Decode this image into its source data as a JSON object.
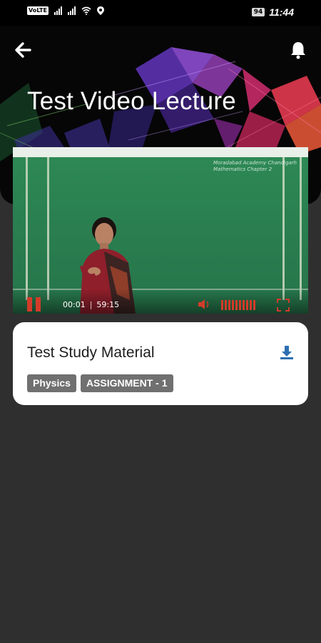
{
  "status_bar": {
    "network_badge": "VoLTE",
    "battery_level": "94",
    "time": "11:44",
    "icons": [
      "volte-icon",
      "signal-icon",
      "signal-icon",
      "wifi-icon",
      "location-icon",
      "battery-icon"
    ]
  },
  "header": {
    "title": "Test Video Lecture",
    "back_icon": "arrow-left-icon",
    "notification_icon": "bell-icon"
  },
  "player": {
    "current_time": "00:01",
    "separator": "|",
    "duration": "59:15",
    "board_text_line1": "Moradabad Academy Chandigarh",
    "board_text_line2": "Mathematics Chapter 2"
  },
  "material": {
    "title": "Test Study Material",
    "tags": [
      "Physics",
      "ASSIGNMENT - 1"
    ],
    "download_icon": "download-icon"
  },
  "colors": {
    "background": "#2f2f2f",
    "header": "#060606",
    "card": "#ffffff",
    "tag": "#707070",
    "accent_red": "#d23b2a",
    "download_blue": "#2d6fb1"
  }
}
